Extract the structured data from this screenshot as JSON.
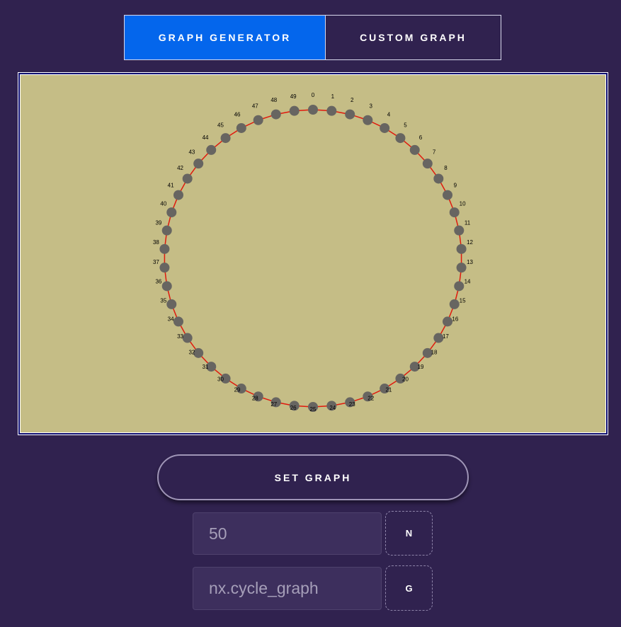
{
  "tabs": [
    {
      "label": "GRAPH GENERATOR",
      "active": true
    },
    {
      "label": "CUSTOM GRAPH",
      "active": false
    }
  ],
  "graph": {
    "generator": "nx.cycle_graph",
    "n": 50,
    "labels": [
      "0",
      "1",
      "2",
      "3",
      "4",
      "5",
      "6",
      "7",
      "8",
      "9",
      "10",
      "11",
      "12",
      "13",
      "14",
      "15",
      "16",
      "17",
      "18",
      "19",
      "20",
      "21",
      "22",
      "23",
      "24",
      "25",
      "26",
      "27",
      "28",
      "29",
      "30",
      "31",
      "32",
      "33",
      "34",
      "35",
      "36",
      "37",
      "38",
      "39",
      "40",
      "41",
      "42",
      "43",
      "44",
      "45",
      "46",
      "47",
      "48",
      "49"
    ],
    "background_color": "#c5bd86",
    "node_color": "#676561",
    "edge_color": "#e0190d",
    "label_color": "#000000"
  },
  "actions": {
    "set_graph_label": "SET GRAPH"
  },
  "inputs": {
    "n_value": "50",
    "n_button_label": "N",
    "g_value": "nx.cycle_graph",
    "g_button_label": "G"
  },
  "colors": {
    "page_background": "#30224f",
    "active_tab": "#0466ec",
    "frame_border": "#0f0f70"
  }
}
